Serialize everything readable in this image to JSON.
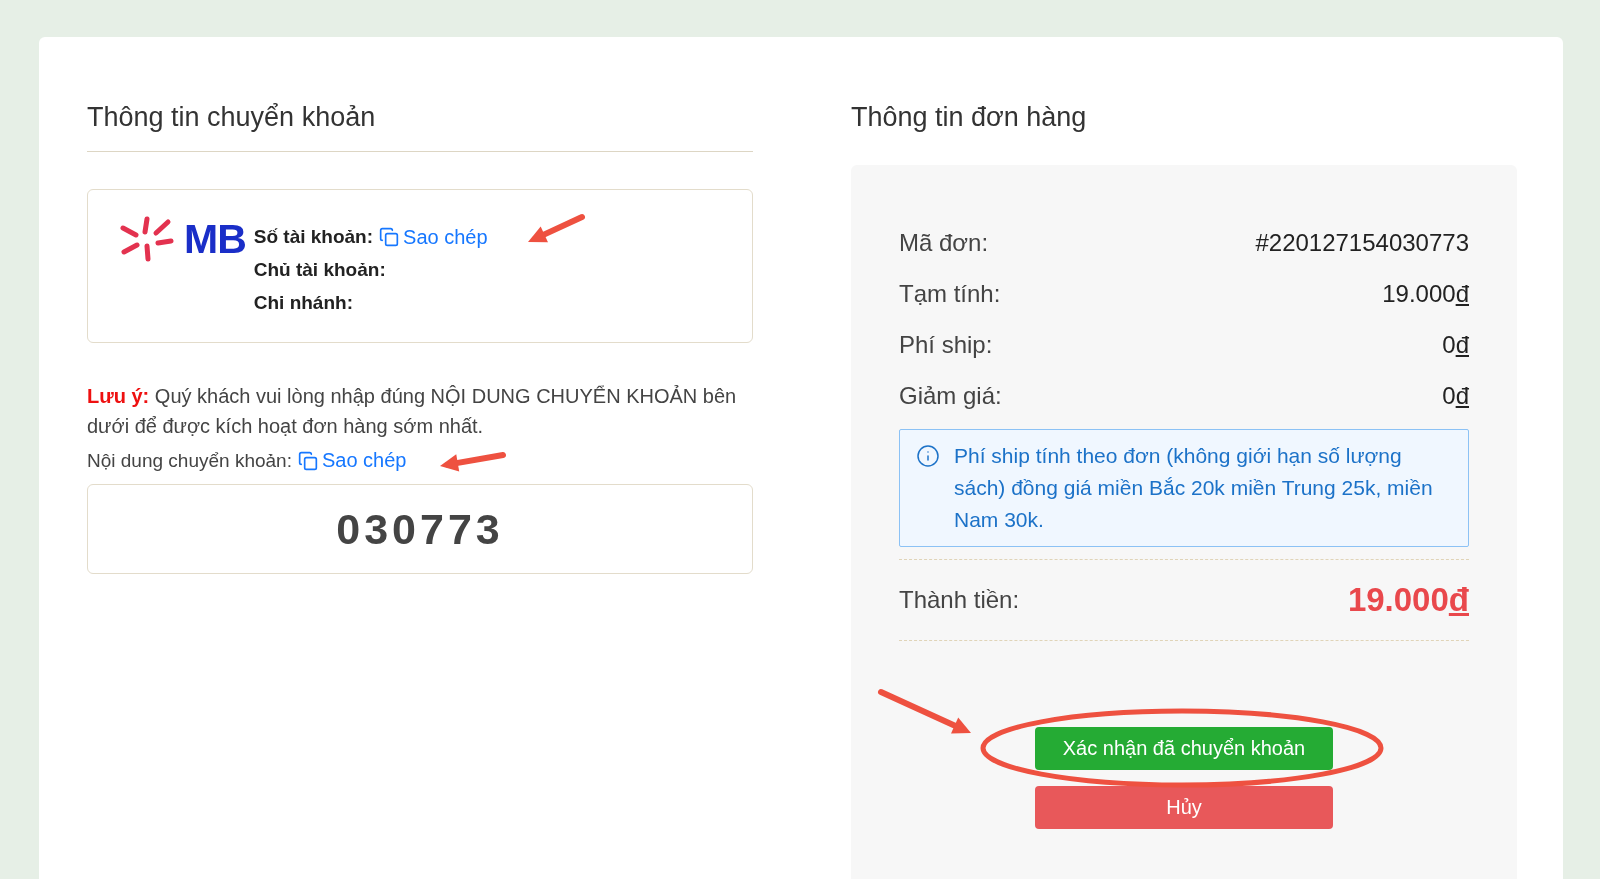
{
  "transfer": {
    "title": "Thông tin chuyển khoản",
    "bank": {
      "logo_text": "MB",
      "fields": [
        {
          "label": "Số tài khoản:",
          "copy": "Sao chép"
        },
        {
          "label": "Chủ tài khoản:"
        },
        {
          "label": "Chi nhánh:"
        }
      ]
    },
    "note": {
      "label": "Lưu ý:",
      "text": "Quý khách vui lòng nhập đúng NỘI DUNG CHUYỂN KHOẢN bên dưới để được kích hoạt đơn hàng sớm nhất."
    },
    "content": {
      "label": "Nội dung chuyển khoản:",
      "copy": "Sao chép",
      "code": "030773"
    }
  },
  "order": {
    "title": "Thông tin đơn hàng",
    "rows": [
      {
        "kind": "text",
        "label": "Mã đơn:",
        "value": "#220127154030773"
      },
      {
        "kind": "money",
        "label": "Tạm tính:",
        "value": "19.000đ"
      },
      {
        "kind": "money",
        "label": "Phí ship:",
        "value": "0đ"
      },
      {
        "kind": "money",
        "label": "Giảm giá:",
        "value": "0đ"
      }
    ],
    "info": "Phí ship tính theo đơn (không giới hạn số lượng sách) đồng giá miền Bắc 20k miền Trung 25k, miền Nam 30k.",
    "total": {
      "label": "Thành tiền:",
      "value": "19.000đ"
    },
    "buttons": [
      {
        "kind": "confirm",
        "label": "Xác nhận đã chuyển khoản"
      },
      {
        "kind": "cancel",
        "label": "Hủy"
      }
    ]
  }
}
